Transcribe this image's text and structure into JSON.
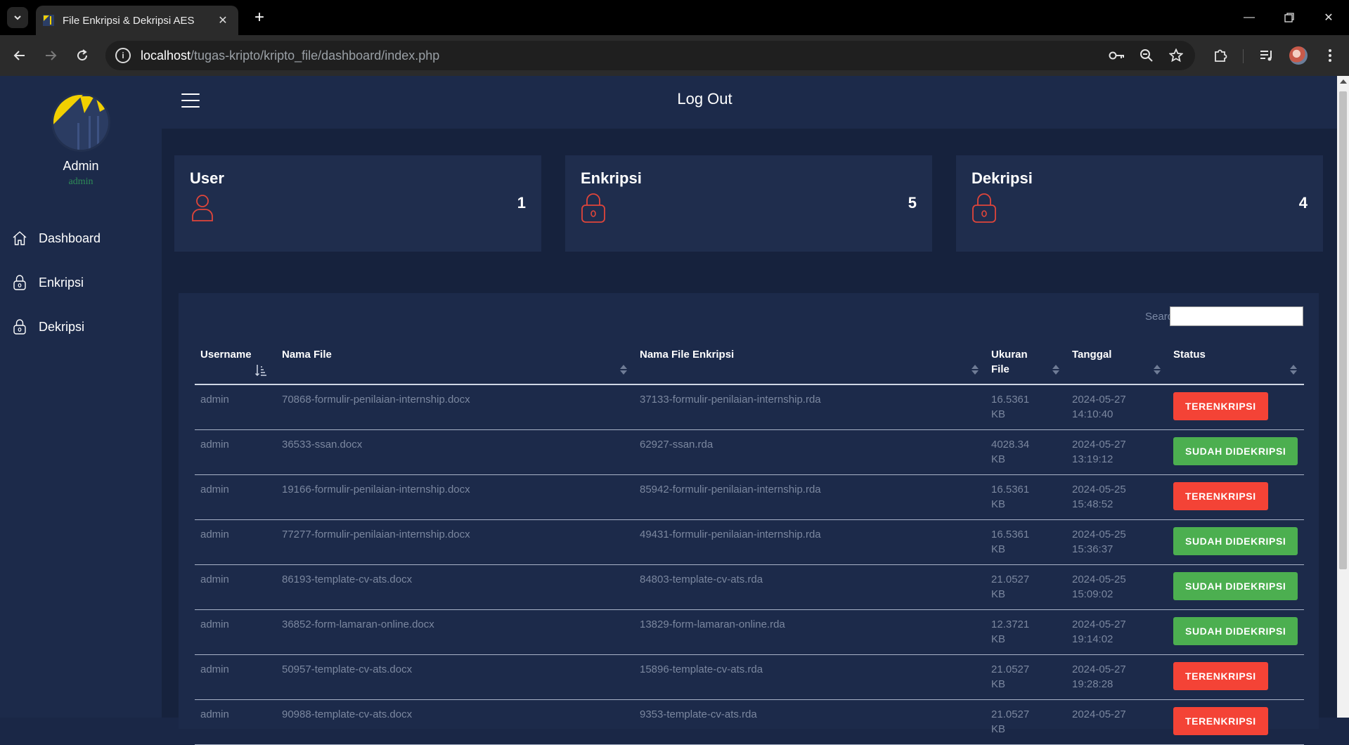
{
  "browser": {
    "tab_title": "File Enkripsi & Dekripsi AES",
    "url_host": "localhost",
    "url_path": "/tugas-kripto/kripto_file/dashboard/index.php"
  },
  "sidebar": {
    "name": "Admin",
    "role": "admin",
    "items": [
      {
        "label": "Dashboard",
        "icon": "home-icon"
      },
      {
        "label": "Enkripsi",
        "icon": "lock-icon"
      },
      {
        "label": "Dekripsi",
        "icon": "lock-icon"
      }
    ]
  },
  "topbar": {
    "logout": "Log Out"
  },
  "cards": [
    {
      "title": "User",
      "count": "1",
      "icon": "user-icon"
    },
    {
      "title": "Enkripsi",
      "count": "5",
      "icon": "lock-icon"
    },
    {
      "title": "Dekripsi",
      "count": "4",
      "icon": "lock-icon"
    }
  ],
  "table": {
    "search_label": "Search:",
    "search_value": "",
    "headers": [
      "Username",
      "Nama File",
      "Nama File Enkripsi",
      "Ukuran File",
      "Tanggal",
      "Status"
    ],
    "rows": [
      {
        "username": "admin",
        "file": "70868-formulir-penilaian-internship.docx",
        "enc": "37133-formulir-penilaian-internship.rda",
        "size": "16.5361 KB",
        "date": "2024-05-27 14:10:40",
        "status": "TERENKRIPSI",
        "status_color": "#f44336"
      },
      {
        "username": "admin",
        "file": "36533-ssan.docx",
        "enc": "62927-ssan.rda",
        "size": "4028.34 KB",
        "date": "2024-05-27 13:19:12",
        "status": "SUDAH DIDEKRIPSI",
        "status_color": "#4caf50"
      },
      {
        "username": "admin",
        "file": "19166-formulir-penilaian-internship.docx",
        "enc": "85942-formulir-penilaian-internship.rda",
        "size": "16.5361 KB",
        "date": "2024-05-25 15:48:52",
        "status": "TERENKRIPSI",
        "status_color": "#f44336"
      },
      {
        "username": "admin",
        "file": "77277-formulir-penilaian-internship.docx",
        "enc": "49431-formulir-penilaian-internship.rda",
        "size": "16.5361 KB",
        "date": "2024-05-25 15:36:37",
        "status": "SUDAH DIDEKRIPSI",
        "status_color": "#4caf50"
      },
      {
        "username": "admin",
        "file": "86193-template-cv-ats.docx",
        "enc": "84803-template-cv-ats.rda",
        "size": "21.0527 KB",
        "date": "2024-05-25 15:09:02",
        "status": "SUDAH DIDEKRIPSI",
        "status_color": "#4caf50"
      },
      {
        "username": "admin",
        "file": "36852-form-lamaran-online.docx",
        "enc": "13829-form-lamaran-online.rda",
        "size": "12.3721 KB",
        "date": "2024-05-27 19:14:02",
        "status": "SUDAH DIDEKRIPSI",
        "status_color": "#4caf50"
      },
      {
        "username": "admin",
        "file": "50957-template-cv-ats.docx",
        "enc": "15896-template-cv-ats.rda",
        "size": "21.0527 KB",
        "date": "2024-05-27 19:28:28",
        "status": "TERENKRIPSI",
        "status_color": "#f44336"
      },
      {
        "username": "admin",
        "file": "90988-template-cv-ats.docx",
        "enc": "9353-template-cv-ats.rda",
        "size": "21.0527 KB",
        "date": "2024-05-27",
        "status": "TERENKRIPSI",
        "status_color": "#f44336"
      }
    ]
  }
}
